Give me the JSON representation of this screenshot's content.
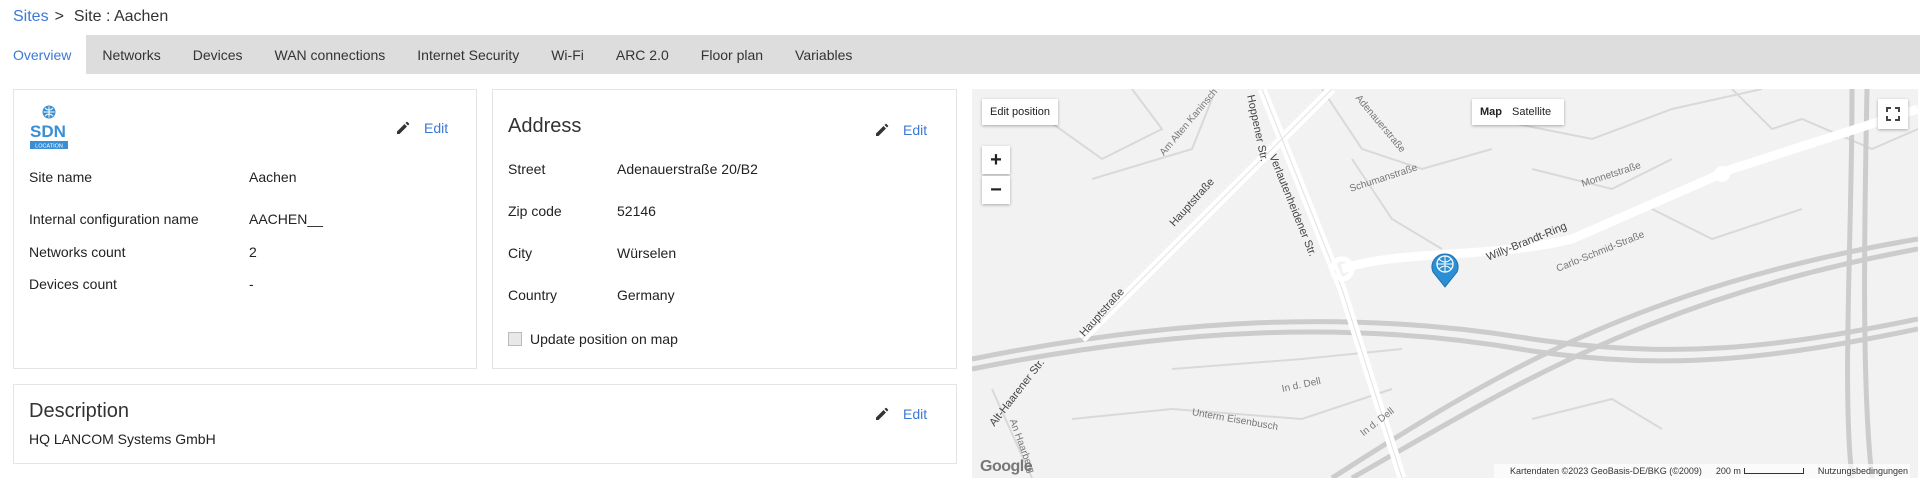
{
  "breadcrumb": {
    "parent": "Sites",
    "separator": ">",
    "current": "Site : Aachen"
  },
  "tabs": [
    {
      "label": "Overview",
      "active": true
    },
    {
      "label": "Networks"
    },
    {
      "label": "Devices"
    },
    {
      "label": "WAN connections"
    },
    {
      "label": "Internet Security"
    },
    {
      "label": "Wi-Fi"
    },
    {
      "label": "ARC 2.0"
    },
    {
      "label": "Floor plan"
    },
    {
      "label": "Variables"
    }
  ],
  "site_card": {
    "logo_text": "SDN",
    "logo_subtext": "LOCATION",
    "edit_label": "Edit",
    "fields": [
      {
        "label": "Site name",
        "value": "Aachen"
      },
      {
        "label": "Internal configuration name",
        "value": "AACHEN__"
      },
      {
        "label": "Networks count",
        "value": "2"
      },
      {
        "label": "Devices count",
        "value": "-"
      }
    ]
  },
  "address_card": {
    "title": "Address",
    "edit_label": "Edit",
    "fields": [
      {
        "label": "Street",
        "value": "Adenauerstraße 20/B2"
      },
      {
        "label": "Zip code",
        "value": "52146"
      },
      {
        "label": "City",
        "value": "Würselen"
      },
      {
        "label": "Country",
        "value": "Germany"
      }
    ],
    "checkbox_label": "Update position on map",
    "checkbox_checked": false
  },
  "description_card": {
    "title": "Description",
    "edit_label": "Edit",
    "text": "HQ LANCOM Systems GmbH"
  },
  "map": {
    "edit_position_label": "Edit position",
    "type_map_label": "Map",
    "type_satellite_label": "Satellite",
    "zoom_in": "+",
    "zoom_out": "−",
    "fullscreen_icon": "fullscreen-icon",
    "google_logo": "Google",
    "attribution": "Kartendaten ©2023 GeoBasis-DE/BKG (©2009)",
    "scale": "200 m",
    "terms": "Nutzungsbedingungen",
    "marker_color": "#2b8fd6",
    "road_labels": [
      "Hauptstraße",
      "Hauptstraße",
      "Verlautenheidener Str.",
      "Willy-Brandt-Ring",
      "Carlo-Schmid-Straße",
      "Monnetstraße",
      "Schumanstraße",
      "Adenauerstraße",
      "Am Alten Kaninsch",
      "Alt-Haarener Str.",
      "Unterm Eisenbusch",
      "In d. Dell",
      "In d. Dell",
      "An Haarberg",
      "Hoppener Str."
    ]
  },
  "colors": {
    "accent": "#3c78d8",
    "tabbar": "#dddddd",
    "card_border": "#e4e4e4"
  }
}
